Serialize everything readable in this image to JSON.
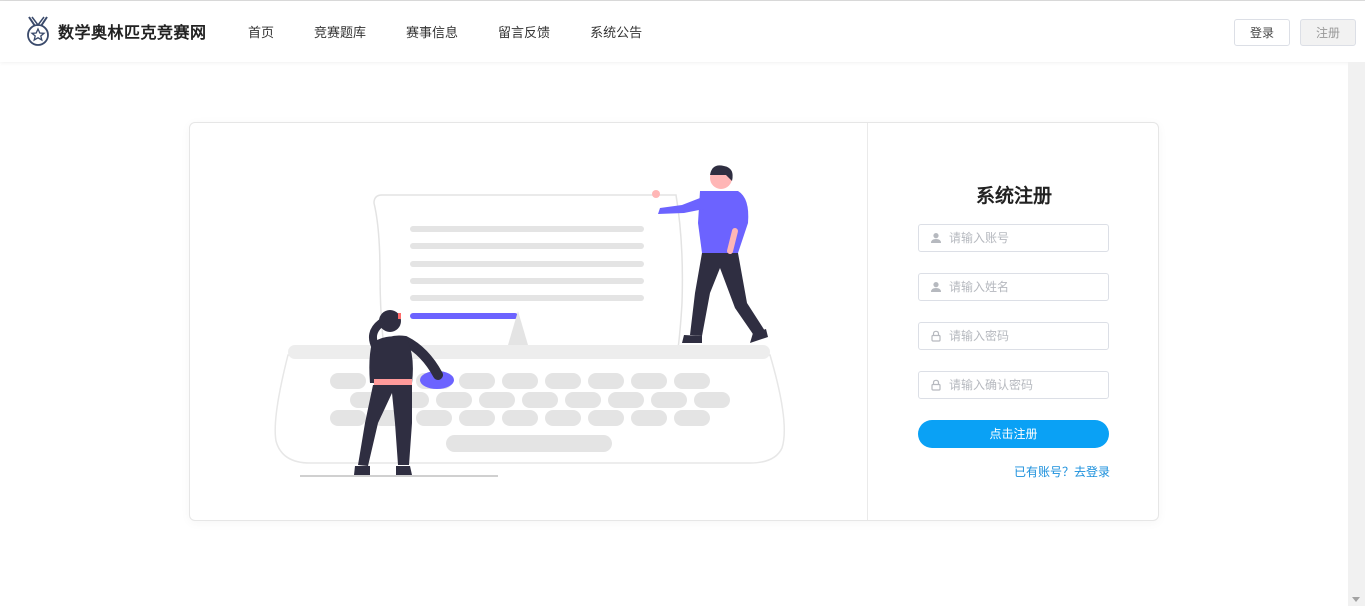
{
  "header": {
    "site_name": "数学奥林匹克竞赛网",
    "nav": [
      "首页",
      "竞赛题库",
      "赛事信息",
      "留言反馈",
      "系统公告"
    ],
    "login_label": "登录",
    "register_label": "注册"
  },
  "form": {
    "title": "系统注册",
    "account_placeholder": "请输入账号",
    "name_placeholder": "请输入姓名",
    "password_placeholder": "请输入密码",
    "confirm_placeholder": "请输入确认密码",
    "submit_label": "点击注册",
    "login_link": "已有账号？去登录"
  },
  "colors": {
    "accent": "#0aa1f5",
    "illustration_purple": "#6c63ff"
  },
  "icons": [
    "medal-logo-icon",
    "user-icon",
    "lock-icon"
  ]
}
